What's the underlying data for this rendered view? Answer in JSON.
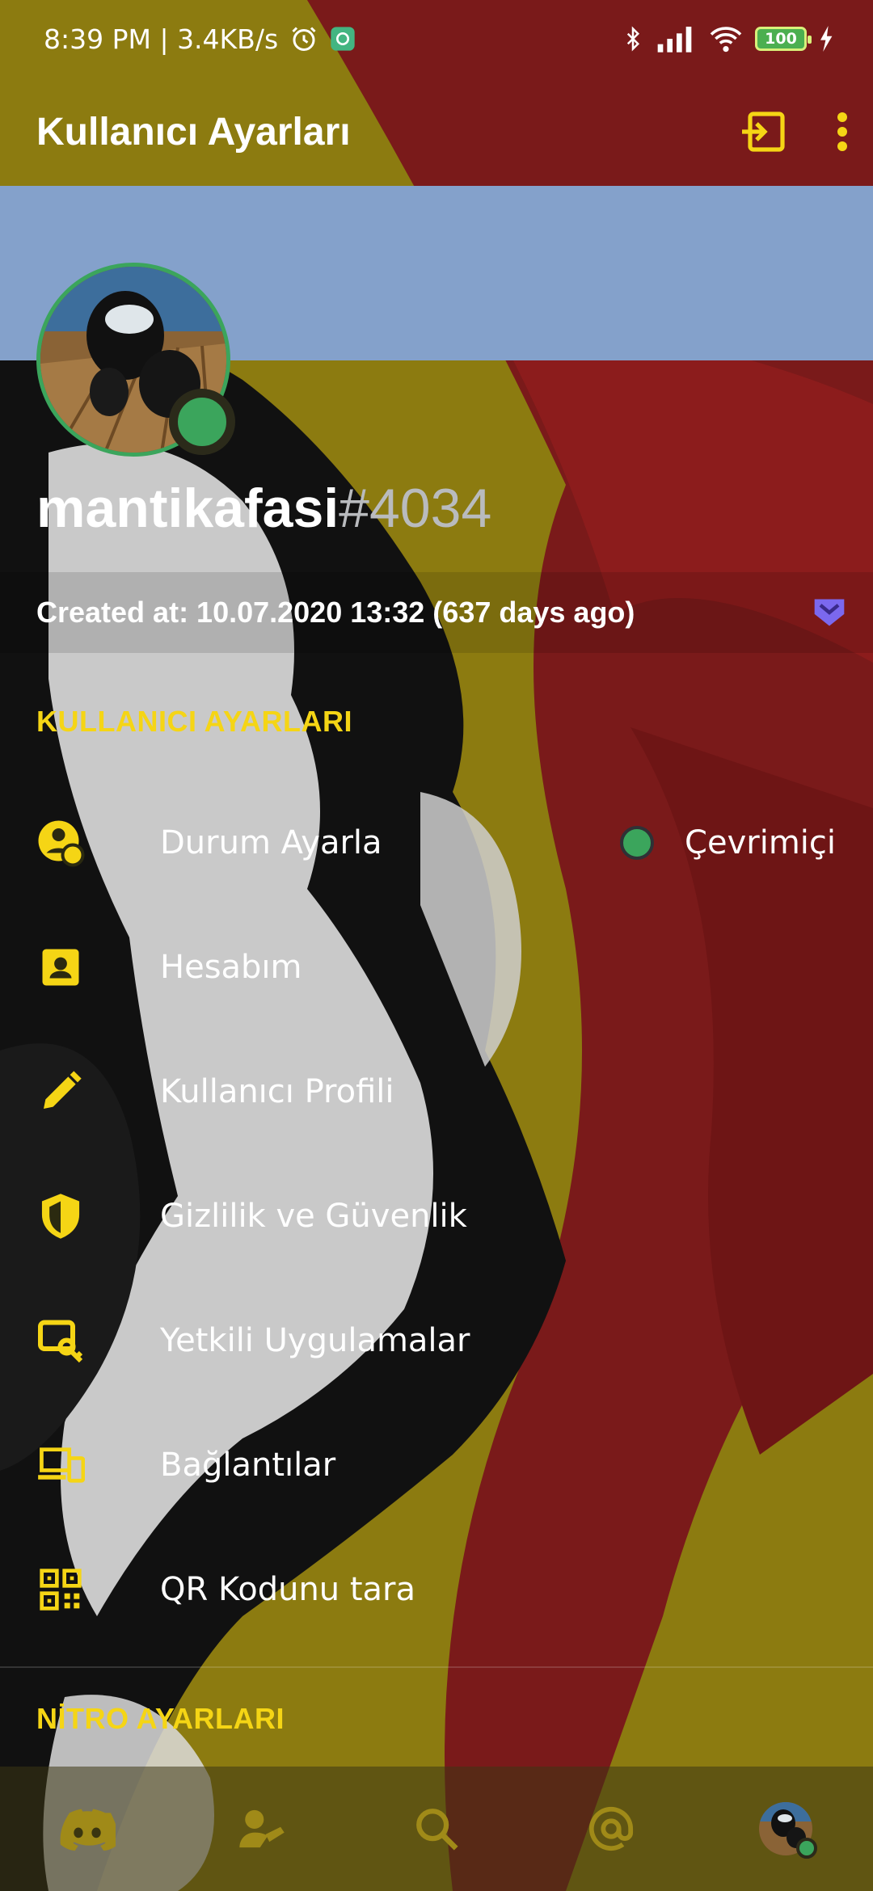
{
  "status_bar": {
    "time_speed": "8:39 PM | 3.4KB/s",
    "battery": "100",
    "icons": [
      "alarm-icon",
      "app-notification-icon",
      "bluetooth-icon",
      "signal-icon",
      "wifi-icon",
      "battery-icon",
      "charging-icon"
    ]
  },
  "app_bar": {
    "title": "Kullanıcı Ayarları",
    "actions": [
      "logout-icon",
      "more-vert-icon"
    ]
  },
  "profile": {
    "username": "mantikafasi",
    "discriminator": "#4034",
    "created": "Created at: 10.07.2020 13:32 (637 days ago)",
    "status_color": "#3ba55c"
  },
  "sections": {
    "user_settings": "KULLANICI AYARLARI",
    "nitro_settings": "NİTRO AYARLARI"
  },
  "settings_items": [
    {
      "label": "Durum Ayarla",
      "icon": "status-icon",
      "value": "Çevrimiçi"
    },
    {
      "label": "Hesabım",
      "icon": "account-icon"
    },
    {
      "label": "Kullanıcı Profili",
      "icon": "pencil-icon"
    },
    {
      "label": "Gizlilik ve Güvenlik",
      "icon": "shield-icon"
    },
    {
      "label": "Yetkili Uygulamalar",
      "icon": "apps-key-icon"
    },
    {
      "label": "Bağlantılar",
      "icon": "devices-icon"
    },
    {
      "label": "QR Kodunu tara",
      "icon": "qr-code-icon"
    }
  ],
  "bottom_nav": [
    "discord-home-icon",
    "friends-icon",
    "search-icon",
    "mentions-icon",
    "profile-avatar"
  ],
  "colors": {
    "accent": "#f5d515",
    "banner": "#84a1cb",
    "online": "#3ba55c",
    "badge": "#7b68ee"
  }
}
